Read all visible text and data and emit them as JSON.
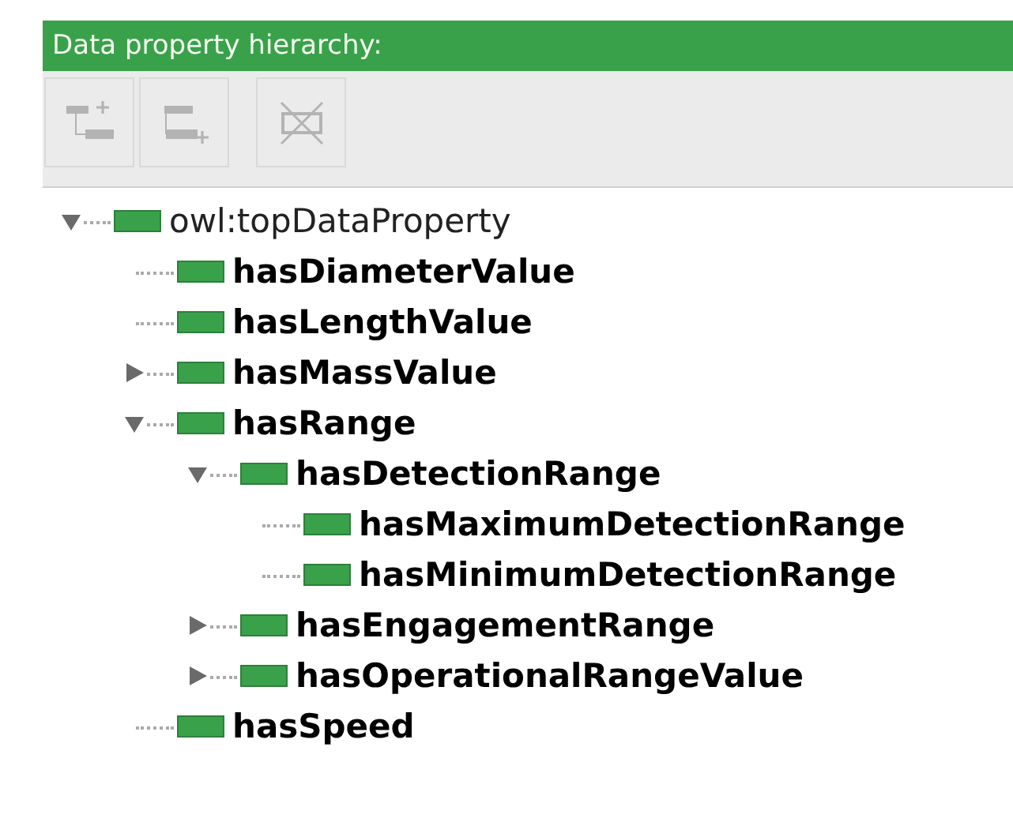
{
  "panel": {
    "title": "Data property hierarchy:"
  },
  "toolbar": [
    {
      "kind": "add-sub",
      "disabled": true
    },
    {
      "kind": "add-sibling",
      "disabled": true
    },
    {
      "kind": "delete",
      "disabled": true
    }
  ],
  "tree": [
    {
      "label": "owl:topDataProperty",
      "bold": false,
      "expanded": true,
      "children": [
        {
          "label": "hasDiameterValue",
          "bold": true
        },
        {
          "label": "hasLengthValue",
          "bold": true
        },
        {
          "label": "hasMassValue",
          "bold": true,
          "expanded": false
        },
        {
          "label": "hasRange",
          "bold": true,
          "expanded": true,
          "children": [
            {
              "label": "hasDetectionRange",
              "bold": true,
              "expanded": true,
              "children": [
                {
                  "label": "hasMaximumDetectionRange",
                  "bold": true
                },
                {
                  "label": "hasMinimumDetectionRange",
                  "bold": true
                }
              ]
            },
            {
              "label": "hasEngagementRange",
              "bold": true,
              "expanded": false
            },
            {
              "label": "hasOperationalRangeValue",
              "bold": true,
              "expanded": false
            }
          ]
        },
        {
          "label": "hasSpeed",
          "bold": true
        }
      ]
    }
  ]
}
